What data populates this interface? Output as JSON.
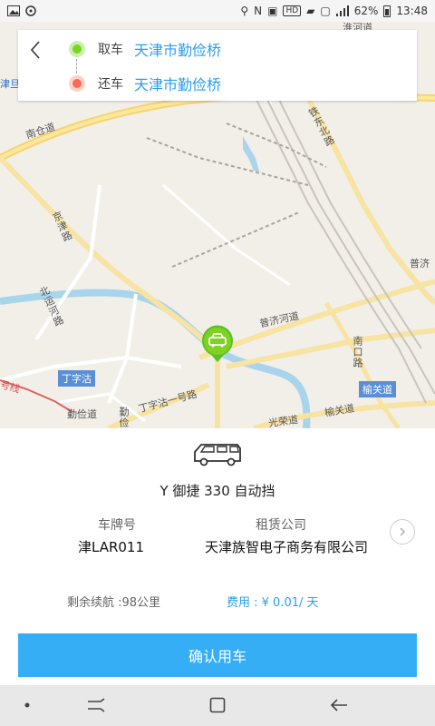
{
  "status_bar": {
    "battery_percent": "62%",
    "time": "13:48",
    "hd_badge": "HD",
    "icons": [
      "image-icon",
      "sync-icon",
      "location-icon",
      "nfc-icon",
      "vibrate-icon",
      "hd-icon",
      "message-icon",
      "sim-icon",
      "signal-icon",
      "battery-icon"
    ]
  },
  "location": {
    "pickup_label": "取车",
    "pickup_value": "天津市勤俭桥",
    "return_label": "还车",
    "return_value": "天津市勤俭桥"
  },
  "map": {
    "labels": {
      "nancang_road": "南仓道",
      "tiedong_north_road": "铁东北路",
      "jingjin_road": "京津路",
      "beiyunhe_road": "北运河路",
      "pujihe_road": "普济河道",
      "dingzigu": "丁字沽",
      "qinjian_road": "勤俭道",
      "dingzigu_yi_road": "丁字沽一号路",
      "nankou_road": "南口路",
      "yuguan_road": "榆关道",
      "yuguan_road_badge": "榆关道",
      "guangrong_road": "光荣道",
      "qinjian_bridge": "勤俭道",
      "huaihe_road": "淮河道",
      "pu_partial": "普济",
      "jin_partial": "津旦",
      "line_partial": "号线"
    }
  },
  "car": {
    "model": "Y 御捷 330 自动挡",
    "plate_label": "车牌号",
    "plate_value": "津LAR011",
    "company_label": "租赁公司",
    "company_value": "天津族智电子商务有限公司",
    "range_text": "剩余续航 :98公里",
    "fee_text": "费用 : ¥ 0.01/ 天"
  },
  "actions": {
    "confirm_label": "确认用车"
  }
}
